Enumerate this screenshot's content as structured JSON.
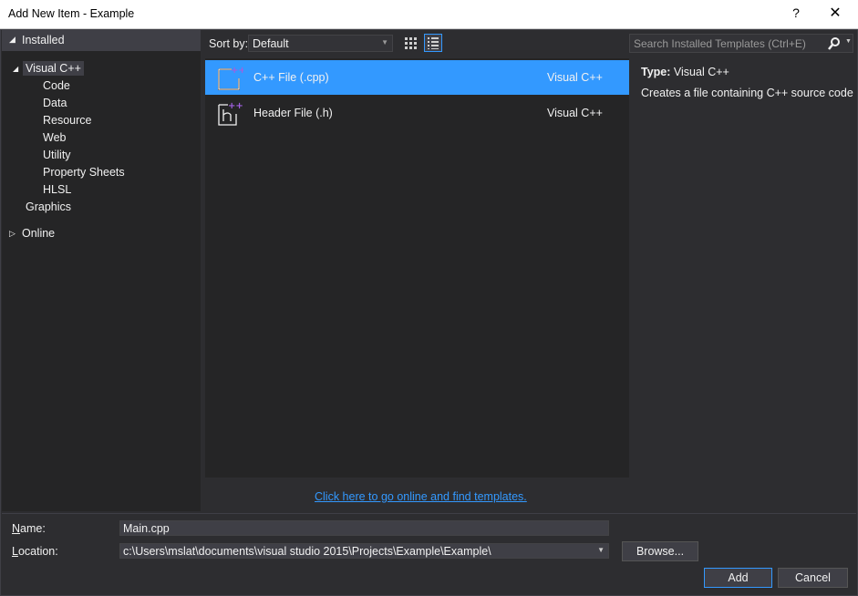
{
  "window": {
    "title": "Add New Item - Example",
    "help": "?",
    "close": "✕"
  },
  "sidebar": {
    "installed_label": "Installed",
    "visual_cpp": "Visual C++",
    "children": [
      "Code",
      "Data",
      "Resource",
      "Web",
      "Utility",
      "Property Sheets",
      "HLSL"
    ],
    "graphics": "Graphics",
    "online": "Online"
  },
  "sort": {
    "label": "Sort by:",
    "value": "Default"
  },
  "search": {
    "placeholder": "Search Installed Templates (Ctrl+E)"
  },
  "templates": [
    {
      "name": "C++ File (.cpp)",
      "language": "Visual C++",
      "selected": true,
      "icon": "cpp-file-icon"
    },
    {
      "name": "Header File (.h)",
      "language": "Visual C++",
      "selected": false,
      "icon": "header-file-icon"
    }
  ],
  "details": {
    "type_label": "Type:",
    "type_value": "Visual C++",
    "description": "Creates a file containing C++ source code"
  },
  "online_link": "Click here to go online and find templates.",
  "form": {
    "name_label": "Name:",
    "name_value": "Main.cpp",
    "location_label": "Location:",
    "location_value": "c:\\Users\\mslat\\documents\\visual studio 2015\\Projects\\Example\\Example\\",
    "browse": "Browse...",
    "add": "Add",
    "cancel": "Cancel"
  },
  "colors": {
    "accent": "#3399ff",
    "background": "#2d2d30",
    "panel": "#252526"
  }
}
